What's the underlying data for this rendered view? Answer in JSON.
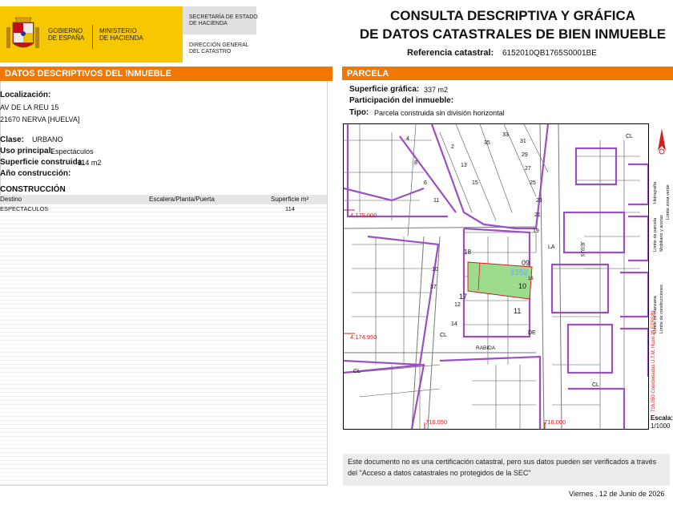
{
  "header": {
    "logo_lines": [
      "GOBIERNO",
      "DE ESPAÑA"
    ],
    "ministry_lines": [
      "MINISTERIO",
      "DE HACIENDA"
    ],
    "secretaria_lines": [
      "SECRETARÍA DE ESTADO",
      "DE HACIENDA"
    ],
    "direccion_lines": [
      "DIRECCIÓN GENERAL",
      "DEL CATASTRO"
    ],
    "title_line1": "CONSULTA DESCRIPTIVA Y GRÁFICA",
    "title_line2": "DE DATOS CATASTRALES DE BIEN INMUEBLE",
    "ref_label": "Referencia catastral:",
    "ref_value": "6152010QB1765S0001BE"
  },
  "left": {
    "section_title": "DATOS DESCRIPTIVOS DEL INMUEBLE",
    "localizacion_label": "Localización:",
    "address_line1": "AV DE LA REU 15",
    "address_line2": "21670 NERVA [HUELVA]",
    "clase_label": "Clase:",
    "clase_value": "URBANO",
    "uso_label": "Uso principal:",
    "uso_value": "Espectáculos",
    "superficie_label": "Superficie construida:",
    "superficie_value": "114 m2",
    "anio_label": "Año construcción:",
    "anio_value": "",
    "construccion_title": "CONSTRUCCIÓN",
    "table_headers": [
      "Destino",
      "Escalera/Planta/Puerta",
      "Superficie m²"
    ],
    "table_rows": [
      {
        "destino": "ESPECTACULOS",
        "escalera": "",
        "superficie": "114"
      }
    ]
  },
  "right": {
    "section_title": "PARCELA",
    "superficie_grafica_label": "Superficie gráfica:",
    "superficie_grafica_value": "337 m2",
    "participacion_label": "Participación del inmueble:",
    "participacion_value": "",
    "tipo_label": "Tipo:",
    "tipo_value": "Parcela construida sin división horizontal"
  },
  "map": {
    "coord_y1": "4.175.000",
    "coord_y2": "4.174.950",
    "coord_x1": "716.050",
    "coord_x2": "716.000",
    "parcel_ref": "6152",
    "street_labels": [
      "CL",
      "CL",
      "CL",
      "LA",
      "JESUS",
      "RABIDA",
      "DE",
      "CL"
    ],
    "numbers": [
      "18",
      "09",
      "10",
      "17",
      "11",
      "14",
      "16",
      "12",
      "19",
      "21",
      "23",
      "25",
      "27",
      "29",
      "31",
      "33",
      "35",
      "37",
      "10",
      "11",
      "6",
      "8",
      "4",
      "2",
      "13",
      "15",
      "17"
    ],
    "legend_items": [
      "Límite de manzana",
      "Límite de parcela",
      "Límite de construcciones",
      "Mobiliario y aceras",
      "Límite zona verde",
      "Hidrografía"
    ],
    "coords_note": "716,050 Coordenadas U.T.M. Huso 29 ETRS89",
    "scale_label": "Escala:",
    "scale_value": "1/1000"
  },
  "footer": {
    "note": "Este documento no es una certificación catastral, pero sus datos pueden ser verificados a través del \"Acceso a datos catastrales no protegidos de la SEC\"",
    "date": "Viernes , 12 de Junio de 2026"
  }
}
